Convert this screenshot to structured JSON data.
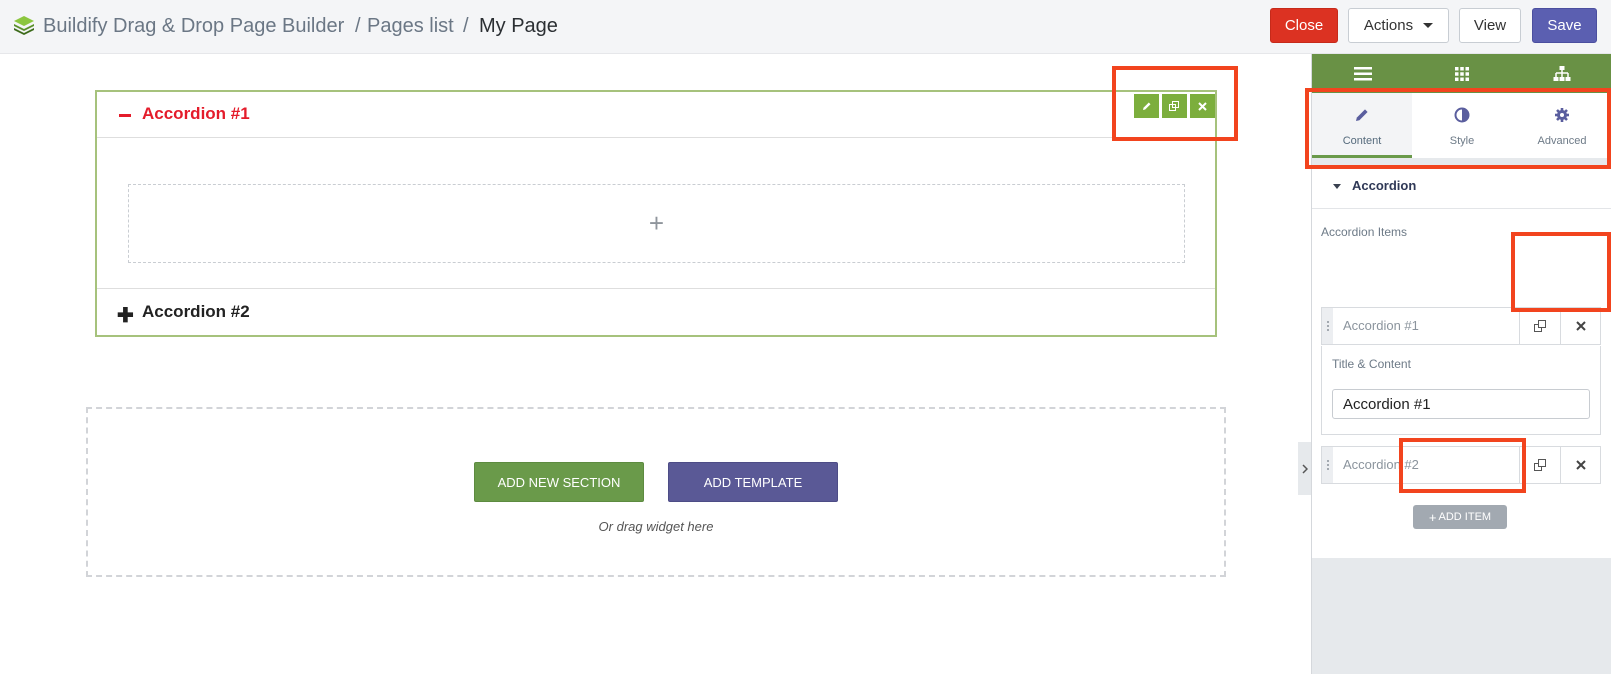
{
  "header": {
    "app_title": "Buildify Drag & Drop Page Builder",
    "sep1": "/",
    "pages_link": "Pages list",
    "sep2": "/",
    "current_page": "My Page",
    "close_label": "Close",
    "actions_label": "Actions",
    "view_label": "View",
    "save_label": "Save"
  },
  "canvas": {
    "accordion_items": [
      {
        "title": "Accordion #1",
        "expanded": true,
        "icon": "minus-icon"
      },
      {
        "title": "Accordion #2",
        "expanded": false,
        "icon": "plus-icon"
      }
    ],
    "add_widget_symbol": "+",
    "widget_tools": [
      "pencil-icon",
      "duplicate-icon",
      "close-icon"
    ],
    "add_section_label": "ADD NEW SECTION",
    "add_template_label": "ADD TEMPLATE",
    "drag_hint": "Or drag widget here"
  },
  "panel": {
    "top_icons": [
      "menu-icon",
      "grid-icon",
      "hierarchy-icon"
    ],
    "tabs": [
      {
        "label": "Content",
        "icon": "pencil-icon",
        "active": true
      },
      {
        "label": "Style",
        "icon": "contrast-icon",
        "active": false
      },
      {
        "label": "Advanced",
        "icon": "gear-icon",
        "active": false
      }
    ],
    "section_title": "Accordion",
    "items_label": "Accordion Items",
    "items": [
      {
        "title": "Accordion #1",
        "expanded": true
      },
      {
        "title": "Accordion #2",
        "expanded": false
      }
    ],
    "field_label": "Title & Content",
    "field_value": "Accordion #1",
    "add_item_label": "ADD ITEM"
  },
  "colors": {
    "brand_green": "#699145",
    "accent_purple": "#5b5fb1",
    "danger_red": "#dc3222",
    "accordion_active_title": "#e41c2b",
    "highlight": "#f2441e"
  }
}
